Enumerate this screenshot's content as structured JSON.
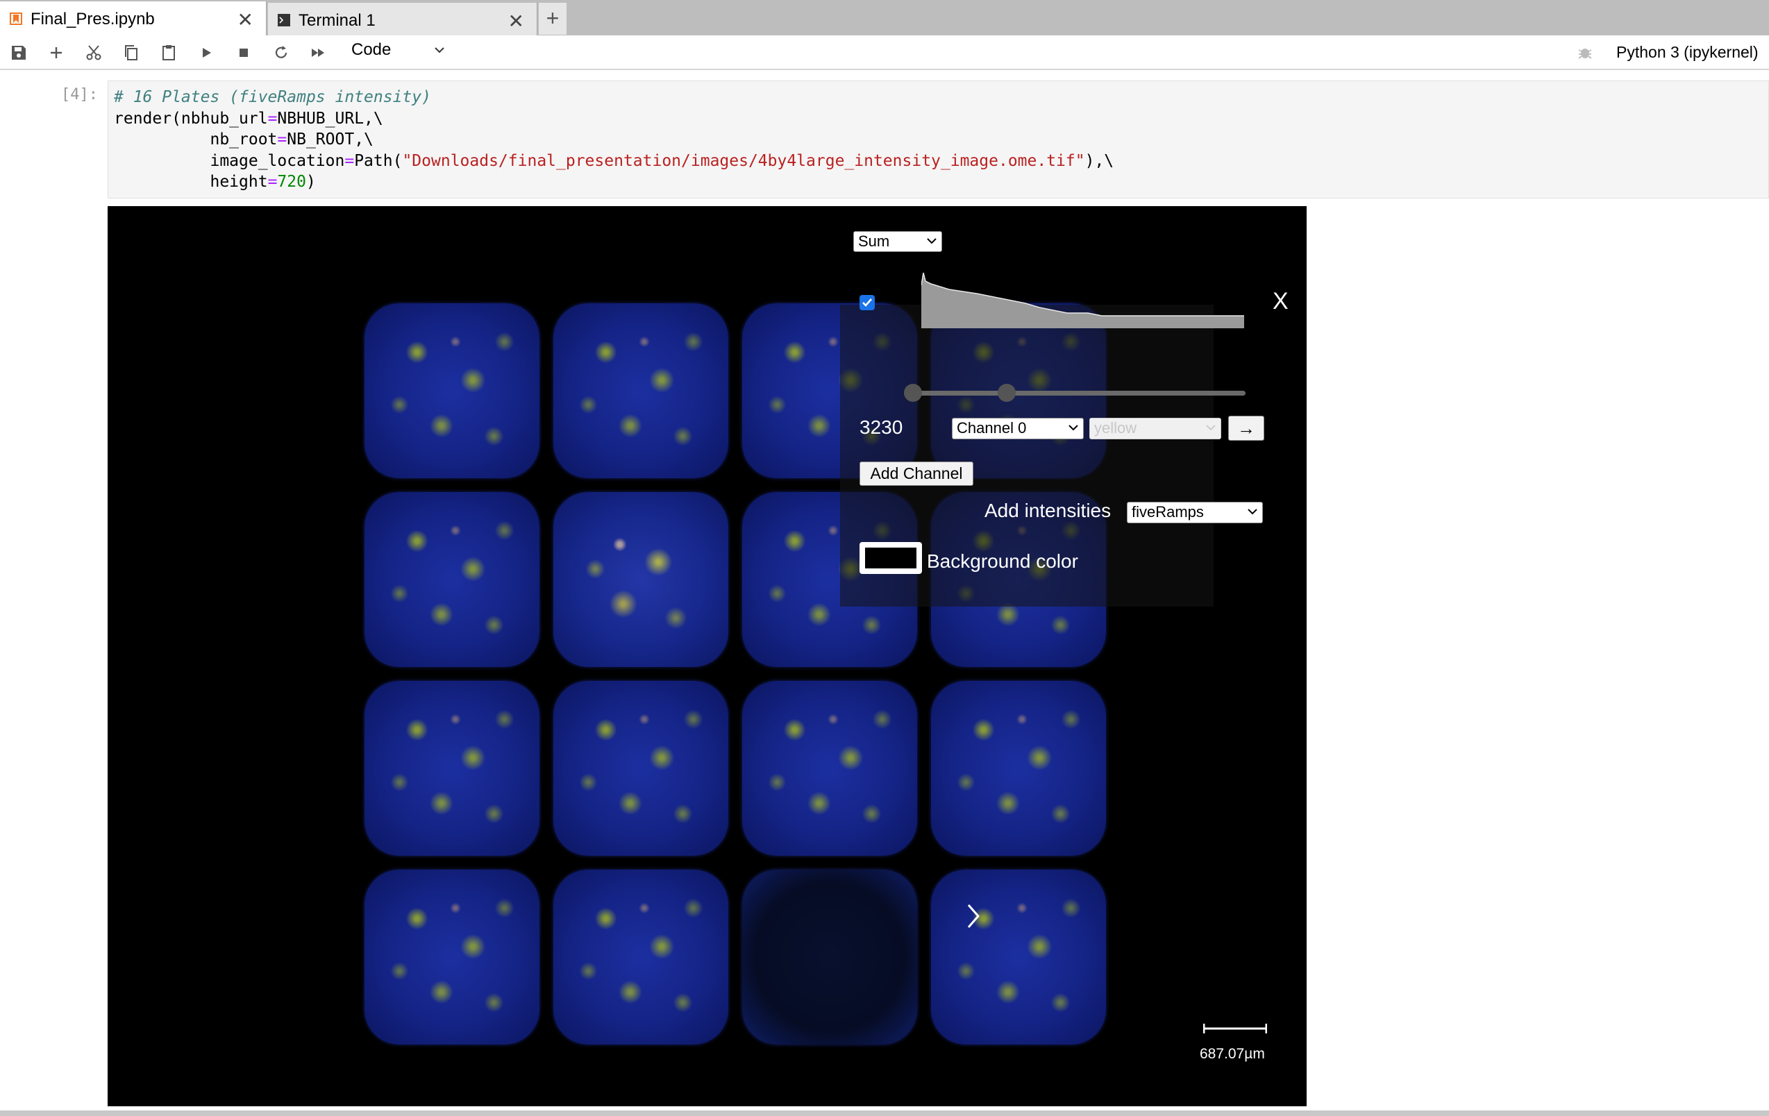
{
  "tabs": [
    {
      "label": "Final_Pres.ipynb",
      "active": true,
      "icon": "notebook-icon",
      "close": "✕"
    },
    {
      "label": "Terminal 1",
      "active": false,
      "icon": "terminal-icon",
      "close": "✕"
    }
  ],
  "tab_add": "+",
  "toolbar": {
    "icons": [
      "save-icon",
      "add-cell-icon",
      "cut-icon",
      "copy-icon",
      "paste-icon",
      "run-icon",
      "stop-icon",
      "restart-icon",
      "run-all-icon"
    ],
    "cell_type": "Code",
    "kernel_name": "Python 3 (ipykernel)",
    "kernel_status_icon": "bug-icon"
  },
  "cell": {
    "prompt": "[4]:",
    "code": {
      "comment": "# 16 Plates (fiveRamps intensity)",
      "l2a": "render(nbhub_url",
      "l2b": "=",
      "l2c": "NBHUB_URL,\\",
      "l3a": "          nb_root",
      "l3b": "=",
      "l3c": "NB_ROOT,\\",
      "l4a": "          image_location",
      "l4b": "=",
      "l4c": "Path(",
      "l4d": "\"Downloads/final_presentation/images/4by4large_intensity_image.ome.tif\"",
      "l4e": "),\\",
      "l5a": "          height",
      "l5b": "=",
      "l5c": "720",
      "l5d": ")"
    }
  },
  "viewer": {
    "mode_select": "Sum",
    "channel_enabled": true,
    "close_label": "X",
    "slider_value_label": "3230",
    "slider_range": [
      0.0,
      0.29
    ],
    "channel_select": "Channel 0",
    "color_select": "yellow",
    "apply_button": "→",
    "add_channel_button": "Add Channel",
    "add_intensities_label": "Add intensities",
    "intensities_select": "fiveRamps",
    "background_color_label": "Background color",
    "background_color": "#000000",
    "scale_bar_label": "687.07µm",
    "wells": [
      [
        "normal",
        "normal",
        "normal",
        "normal"
      ],
      [
        "normal",
        "bright",
        "normal",
        "normal"
      ],
      [
        "normal",
        "normal",
        "normal",
        "normal"
      ],
      [
        "normal",
        "normal",
        "dim",
        "normal"
      ]
    ]
  },
  "colors": {
    "accent": "#1a73e8",
    "viewer_background": "#000000",
    "well_blue": "#1c2fa0"
  }
}
